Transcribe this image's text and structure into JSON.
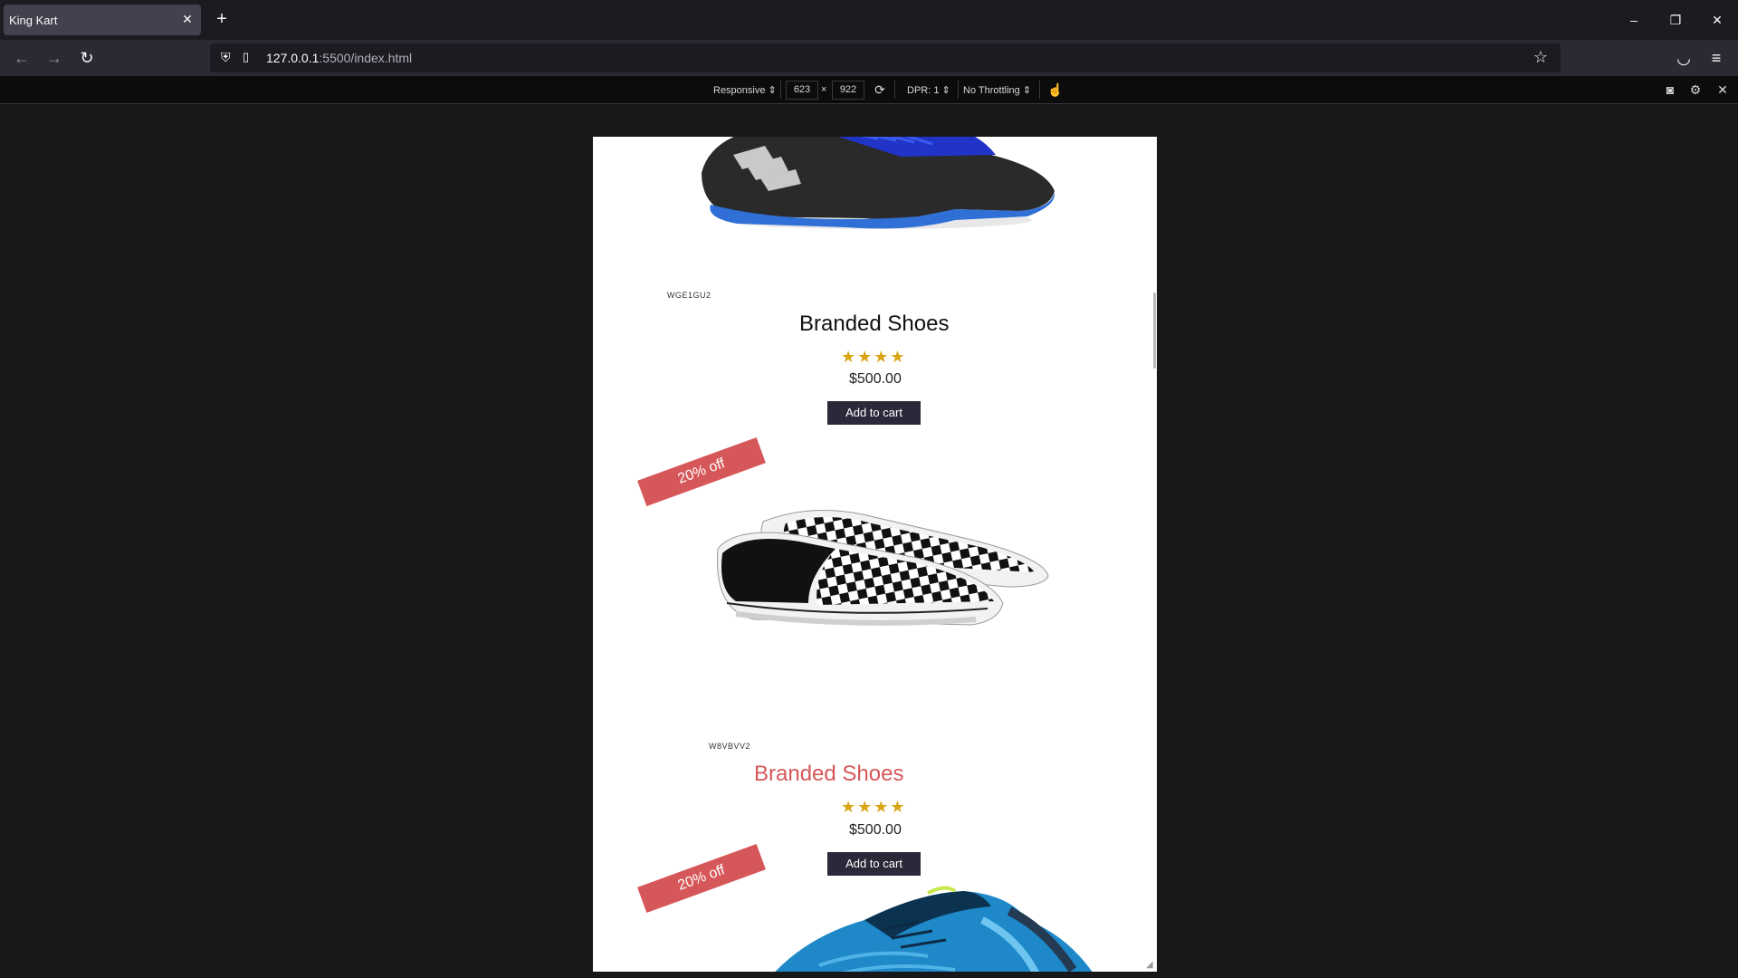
{
  "browser": {
    "tab_title": "King Kart",
    "url_host": "127.0.0.1",
    "url_path": ":5500/index.html"
  },
  "rdm": {
    "device": "Responsive",
    "width": "623",
    "height": "922",
    "dpr": "DPR: 1",
    "throttling": "No Throttling",
    "times": "×"
  },
  "page": {
    "products": [
      {
        "code": "WGE1GU2",
        "title": "Branded Shoes",
        "rating_stars": 4,
        "price": "$500.00",
        "button": "Add to cart"
      },
      {
        "badge": "20% off",
        "code": "W8VBVV2",
        "title": "Branded Shoes",
        "rating_stars": 4,
        "price": "$500.00",
        "button": "Add to cart"
      },
      {
        "badge": "20% off"
      }
    ]
  },
  "colors": {
    "badge": "#d6575a",
    "button": "#2a2839",
    "stars": "#d9a514",
    "title_highlight": "#d6575a"
  },
  "icons": {
    "star": "★",
    "close": "✕",
    "new_tab": "+",
    "back": "←",
    "forward": "→",
    "reload": "↻"
  }
}
